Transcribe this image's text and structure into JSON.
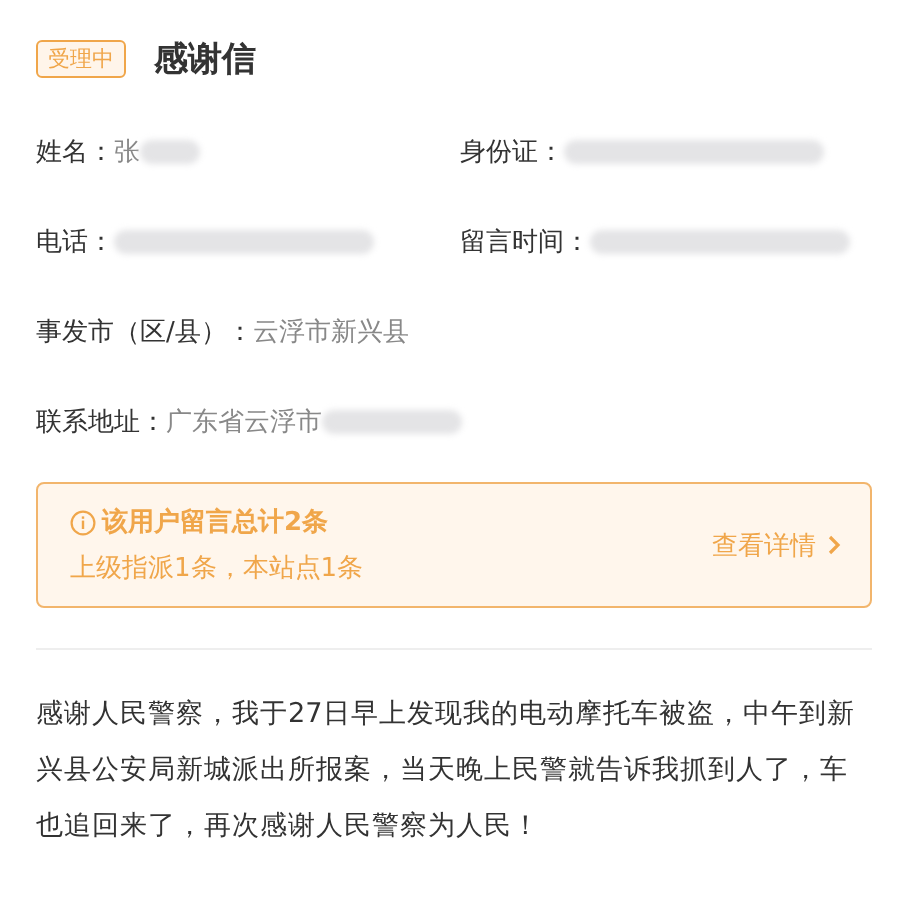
{
  "header": {
    "status": "受理中",
    "title": "感谢信"
  },
  "fields": [
    {
      "label": "姓名：",
      "value": "张",
      "redacted": true
    },
    {
      "label": "身份证：",
      "redacted": true
    },
    {
      "label": "电话：",
      "redacted": true
    },
    {
      "label": "留言时间：",
      "redacted": true
    },
    {
      "label": "事发市（区/县）：",
      "value": "云浮市新兴县",
      "redacted": false,
      "wide": true
    },
    {
      "label": "联系地址：",
      "value": "广东省云浮市",
      "redacted": true,
      "wide": true
    }
  ],
  "notice": {
    "title": "该用户留言总计2条",
    "detail": "上级指派1条，本站点1条",
    "link": "查看详情"
  },
  "message": "感谢人民警察，我于27日早上发现我的电动摩托车被盗，中午到新兴县公安局新城派出所报案，当天晚上民警就告诉我抓到人了，车也追回来了，再次感谢人民警察为人民！"
}
